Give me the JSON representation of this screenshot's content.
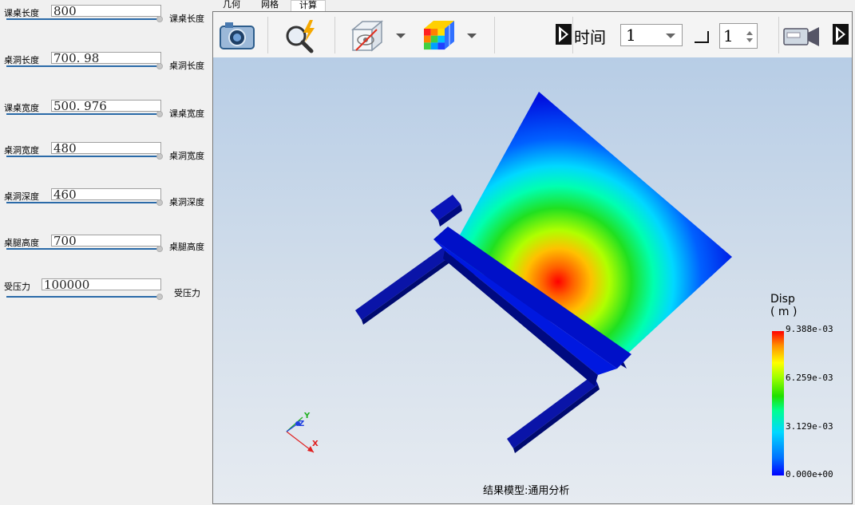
{
  "params": [
    {
      "label": "课桌长度",
      "value": "800",
      "tail": "课桌长度"
    },
    {
      "label": "桌洞长度",
      "value": "700. 98",
      "tail": "桌洞长度"
    },
    {
      "label": "课桌宽度",
      "value": "500. 976",
      "tail": "课桌宽度"
    },
    {
      "label": "桌洞宽度",
      "value": "480",
      "tail": "桌洞宽度"
    },
    {
      "label": "桌洞深度",
      "value": "460",
      "tail": "桌洞深度"
    },
    {
      "label": "桌腿高度",
      "value": "700",
      "tail": "桌腿高度"
    },
    {
      "label": "受压力",
      "value": "100000",
      "tail": "受压力"
    }
  ],
  "tabs": [
    "几何",
    "网格",
    "计算"
  ],
  "active_tab": "计算",
  "toolbar": {
    "icons": [
      "camera-icon",
      "search-lightning-icon",
      "hide-box-icon",
      "color-cube-icon",
      "expand-arrow-icon",
      "video-camera-icon"
    ],
    "time_label": "时间",
    "time_value": "1",
    "step_value": "1"
  },
  "axes": {
    "x": "X",
    "y": "Y",
    "z": "Z"
  },
  "legend": {
    "title_line1": "Disp",
    "title_line2": "( m )",
    "ticks": [
      "9.388e-03",
      "6.259e-03",
      "3.129e-03",
      "0.000e+00"
    ]
  },
  "caption": "结果模型:通用分析",
  "colors": {
    "slider": "#2a6aa8",
    "model_base": "#0000d0"
  }
}
